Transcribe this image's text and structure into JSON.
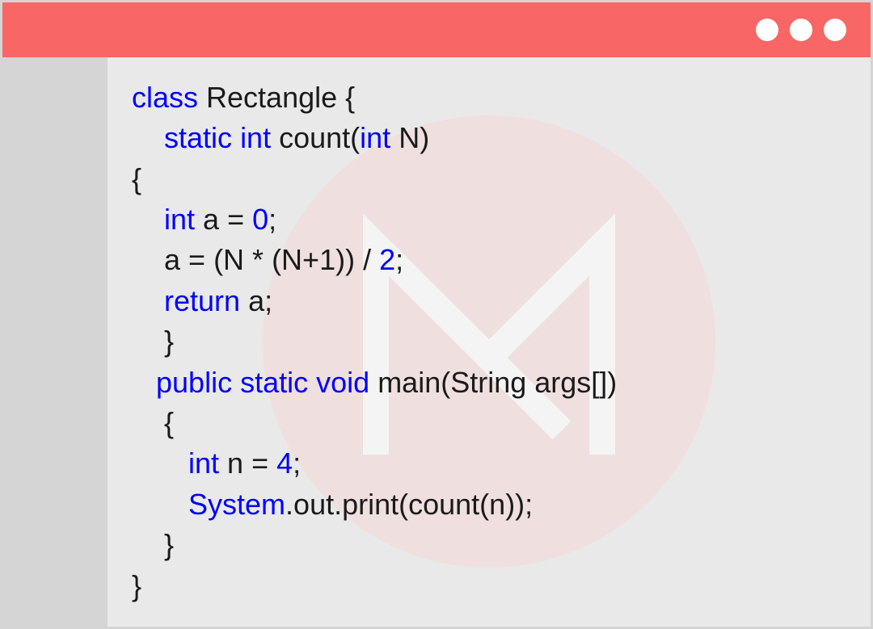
{
  "code_lines": [
    {
      "indent": "",
      "tokens": [
        {
          "t": "class",
          "c": "kw"
        },
        {
          "t": " Rectangle {",
          "c": ""
        }
      ]
    },
    {
      "indent": "    ",
      "tokens": [
        {
          "t": "static",
          "c": "kw"
        },
        {
          "t": " ",
          "c": ""
        },
        {
          "t": "int",
          "c": "kw"
        },
        {
          "t": " count(",
          "c": ""
        },
        {
          "t": "int",
          "c": "kw"
        },
        {
          "t": " N)",
          "c": ""
        }
      ]
    },
    {
      "indent": "",
      "tokens": [
        {
          "t": "{",
          "c": ""
        }
      ]
    },
    {
      "indent": "    ",
      "tokens": [
        {
          "t": "int",
          "c": "kw"
        },
        {
          "t": " a = ",
          "c": ""
        },
        {
          "t": "0",
          "c": "num"
        },
        {
          "t": ";",
          "c": ""
        }
      ]
    },
    {
      "indent": "    ",
      "tokens": [
        {
          "t": "a = (N * (N+1)) / ",
          "c": ""
        },
        {
          "t": "2",
          "c": "num"
        },
        {
          "t": ";",
          "c": ""
        }
      ]
    },
    {
      "indent": "    ",
      "tokens": [
        {
          "t": "return",
          "c": "kw"
        },
        {
          "t": " a;",
          "c": ""
        }
      ]
    },
    {
      "indent": "    ",
      "tokens": [
        {
          "t": "}",
          "c": ""
        }
      ]
    },
    {
      "indent": "   ",
      "tokens": [
        {
          "t": "public",
          "c": "kw"
        },
        {
          "t": " ",
          "c": ""
        },
        {
          "t": "static",
          "c": "kw"
        },
        {
          "t": " ",
          "c": ""
        },
        {
          "t": "void",
          "c": "kw"
        },
        {
          "t": " main(String args[])",
          "c": ""
        }
      ]
    },
    {
      "indent": "    ",
      "tokens": [
        {
          "t": "{",
          "c": ""
        }
      ]
    },
    {
      "indent": "       ",
      "tokens": [
        {
          "t": "int",
          "c": "kw"
        },
        {
          "t": " n = ",
          "c": ""
        },
        {
          "t": "4",
          "c": "num"
        },
        {
          "t": ";",
          "c": ""
        }
      ]
    },
    {
      "indent": "       ",
      "tokens": [
        {
          "t": "System",
          "c": "sys"
        },
        {
          "t": ".out.print(count(n));",
          "c": ""
        }
      ]
    },
    {
      "indent": "    ",
      "tokens": [
        {
          "t": "}",
          "c": ""
        }
      ]
    },
    {
      "indent": "",
      "tokens": [
        {
          "t": "}",
          "c": ""
        }
      ]
    }
  ]
}
